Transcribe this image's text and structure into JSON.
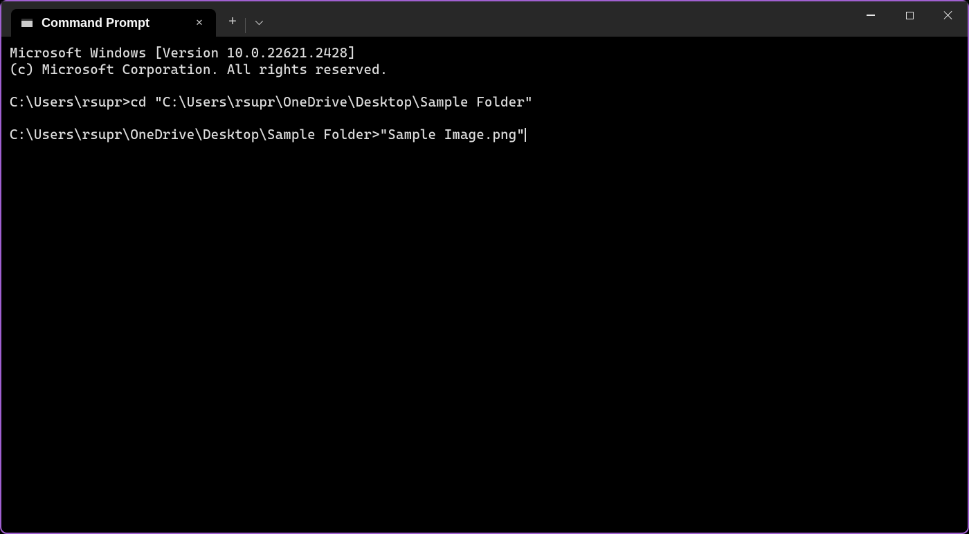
{
  "tab": {
    "title": "Command Prompt"
  },
  "terminal": {
    "line1": "Microsoft Windows [Version 10.0.22621.2428]",
    "line2": "(c) Microsoft Corporation. All rights reserved.",
    "blank1": "",
    "prompt1_path": "C:\\Users\\rsupr>",
    "prompt1_cmd": "cd \"C:\\Users\\rsupr\\OneDrive\\Desktop\\Sample Folder\"",
    "blank2": "",
    "prompt2_path": "C:\\Users\\rsupr\\OneDrive\\Desktop\\Sample Folder>",
    "prompt2_cmd": "\"Sample Image.png\""
  }
}
